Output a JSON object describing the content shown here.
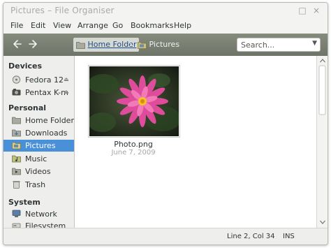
{
  "window": {
    "title": "Pictures – File Organiser",
    "controls": {
      "maximize": "□",
      "close": "×"
    }
  },
  "menubar": [
    "File",
    "Edit",
    "View",
    "Arrange",
    "Go",
    "Bookmarks",
    "Help"
  ],
  "toolbar": {
    "back_icon": "back-arrow-icon",
    "forward_icon": "forward-arrow-icon",
    "breadcrumb": [
      {
        "label": "Home Folder",
        "icon": "home-folder-icon"
      },
      {
        "label": "Pictures",
        "icon": "pictures-folder-icon"
      }
    ],
    "breadcrumb_separator": "›",
    "search": {
      "placeholder": "Search...",
      "value": ""
    }
  },
  "sidebar": {
    "sections": [
      {
        "heading": "Devices",
        "items": [
          {
            "label": "Fedora 12",
            "icon": "drive-icon",
            "eject": true
          },
          {
            "label": "Pentax K-m",
            "icon": "camera-icon",
            "eject": true
          }
        ]
      },
      {
        "heading": "Personal",
        "items": [
          {
            "label": "Home Folder",
            "icon": "home-folder-icon"
          },
          {
            "label": "Downloads",
            "icon": "downloads-icon"
          },
          {
            "label": "Pictures",
            "icon": "pictures-icon",
            "selected": true
          },
          {
            "label": "Music",
            "icon": "music-icon"
          },
          {
            "label": "Videos",
            "icon": "videos-icon"
          },
          {
            "label": "Trash",
            "icon": "trash-icon"
          }
        ]
      },
      {
        "heading": "System",
        "items": [
          {
            "label": "Network",
            "icon": "network-icon"
          },
          {
            "label": "Filesystem",
            "icon": "filesystem-icon"
          }
        ]
      }
    ],
    "eject_glyph": "⏏"
  },
  "files": [
    {
      "name": "Photo.png",
      "date": "June 7, 2009",
      "thumbnail": "pink-dahlia-flower-photo"
    }
  ],
  "statusbar": {
    "position": "Line 2, Col 34",
    "mode": "INS"
  },
  "colors": {
    "selection": "#4a90d9",
    "toolbar": "#7a8073",
    "link": "#1f4b8a"
  }
}
